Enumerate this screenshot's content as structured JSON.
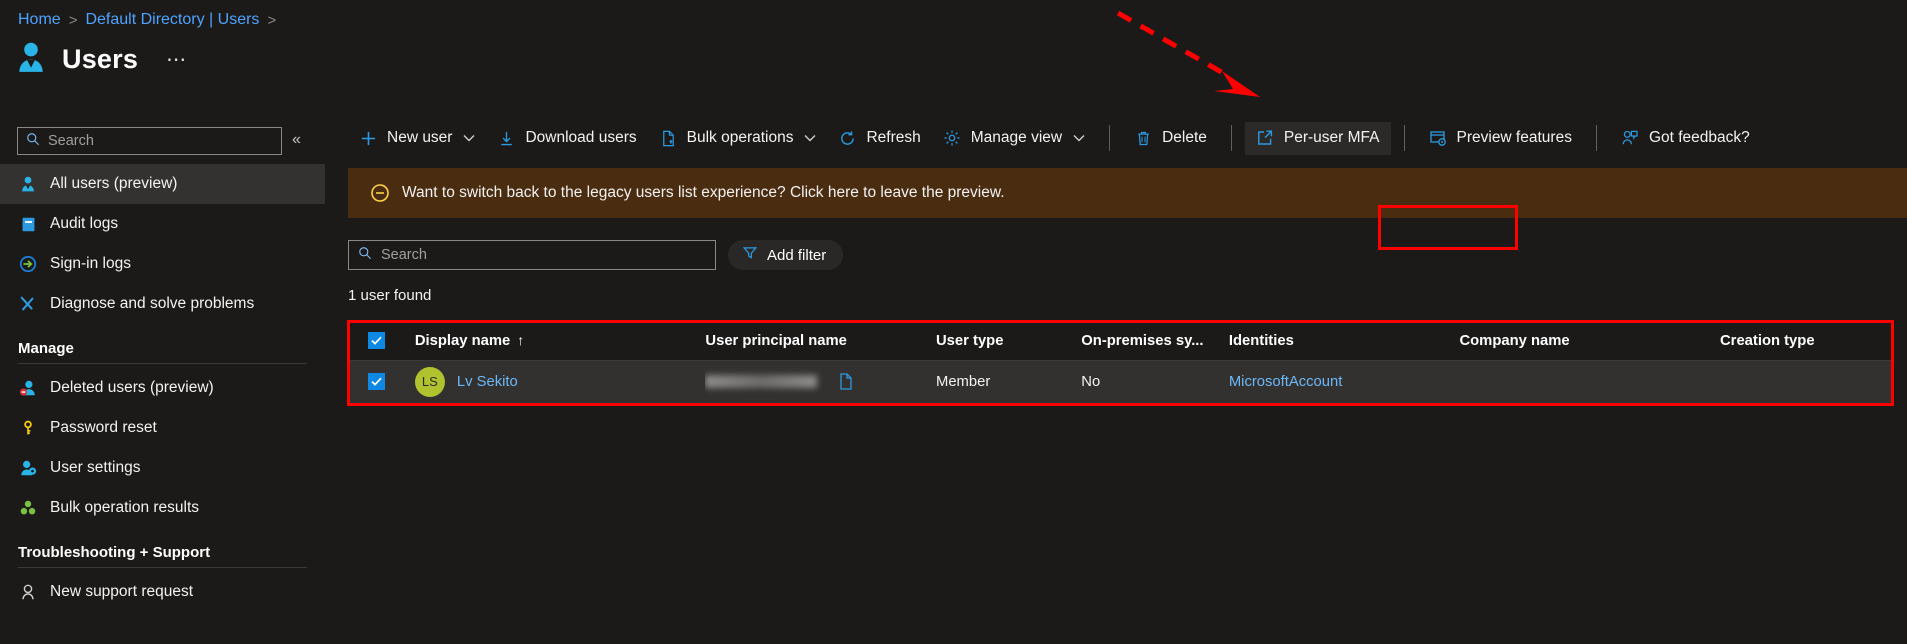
{
  "breadcrumb": {
    "items": [
      {
        "label": "Home"
      },
      {
        "label": "Default Directory | Users"
      }
    ],
    "separator": ">"
  },
  "header": {
    "title": "Users",
    "more_label": "⋯",
    "icon": "user-icon"
  },
  "sidebar": {
    "search": {
      "placeholder": "Search",
      "value": "",
      "icon": "search-icon"
    },
    "collapse_label": "«",
    "items": [
      {
        "label": "All users (preview)",
        "icon": "user-icon",
        "selected": true
      },
      {
        "label": "Audit logs",
        "icon": "audit-log-icon",
        "selected": false
      },
      {
        "label": "Sign-in logs",
        "icon": "sign-in-icon",
        "selected": false
      },
      {
        "label": "Diagnose and solve problems",
        "icon": "wrench-icon",
        "selected": false
      }
    ],
    "groups": [
      {
        "title": "Manage",
        "items": [
          {
            "label": "Deleted users (preview)",
            "icon": "deleted-user-icon"
          },
          {
            "label": "Password reset",
            "icon": "key-icon"
          },
          {
            "label": "User settings",
            "icon": "user-settings-icon"
          },
          {
            "label": "Bulk operation results",
            "icon": "bulk-operations-icon"
          }
        ]
      },
      {
        "title": "Troubleshooting + Support",
        "items": [
          {
            "label": "New support request",
            "icon": "support-person-icon"
          }
        ]
      }
    ]
  },
  "toolbar": {
    "buttons": [
      {
        "label": "New user",
        "icon": "plus-icon",
        "caret": true
      },
      {
        "label": "Download users",
        "icon": "download-icon",
        "caret": false
      },
      {
        "label": "Bulk operations",
        "icon": "bulk-file-icon",
        "caret": true
      },
      {
        "label": "Refresh",
        "icon": "refresh-icon",
        "caret": false
      },
      {
        "label": "Manage view",
        "icon": "gear-icon",
        "caret": true
      },
      {
        "label": "Delete",
        "icon": "trash-icon",
        "caret": false
      },
      {
        "label": "Per-user MFA",
        "icon": "external-link-icon",
        "caret": false,
        "highlighted": true
      },
      {
        "label": "Preview features",
        "icon": "preview-features-icon",
        "caret": false
      },
      {
        "label": "Got feedback?",
        "icon": "feedback-icon",
        "caret": false
      }
    ],
    "caret_glyph": "⌄"
  },
  "banner": {
    "text": "Want to switch back to the legacy users list experience? Click here to leave the preview.",
    "icon": "minus-circle-icon",
    "background": "#4a2c10",
    "icon_color": "#ffd23f"
  },
  "filter": {
    "search": {
      "placeholder": "Search",
      "value": "",
      "icon": "search-icon"
    },
    "add_filter_label": "Add filter",
    "add_filter_icon": "funnel-icon",
    "result_count": "1 user found"
  },
  "table": {
    "columns": [
      {
        "label": "Display name",
        "sort": "↑"
      },
      {
        "label": "User principal name",
        "sort": ""
      },
      {
        "label": "User type",
        "sort": ""
      },
      {
        "label": "On-premises sy...",
        "sort": ""
      },
      {
        "label": "Identities",
        "sort": ""
      },
      {
        "label": "Company name",
        "sort": ""
      },
      {
        "label": "Creation type",
        "sort": ""
      }
    ],
    "header_checkbox_checked": true,
    "rows": [
      {
        "checked": true,
        "initials": "LS",
        "display_name": "Lv Sekito",
        "user_principal_name": "",
        "user_type": "Member",
        "on_premises_sync": "No",
        "identities": "MicrosoftAccount",
        "company_name": "",
        "creation_type": ""
      }
    ]
  },
  "annotations": {
    "highlight_color": "#ff0000",
    "arrow": "dashed-arrow-pointing-to-per-user-mfa"
  },
  "colors": {
    "accent": "#0f88e3",
    "link": "#6cb8f6",
    "background": "#1b1a19",
    "row_background": "#323130",
    "avatar": "#b1c22f"
  }
}
